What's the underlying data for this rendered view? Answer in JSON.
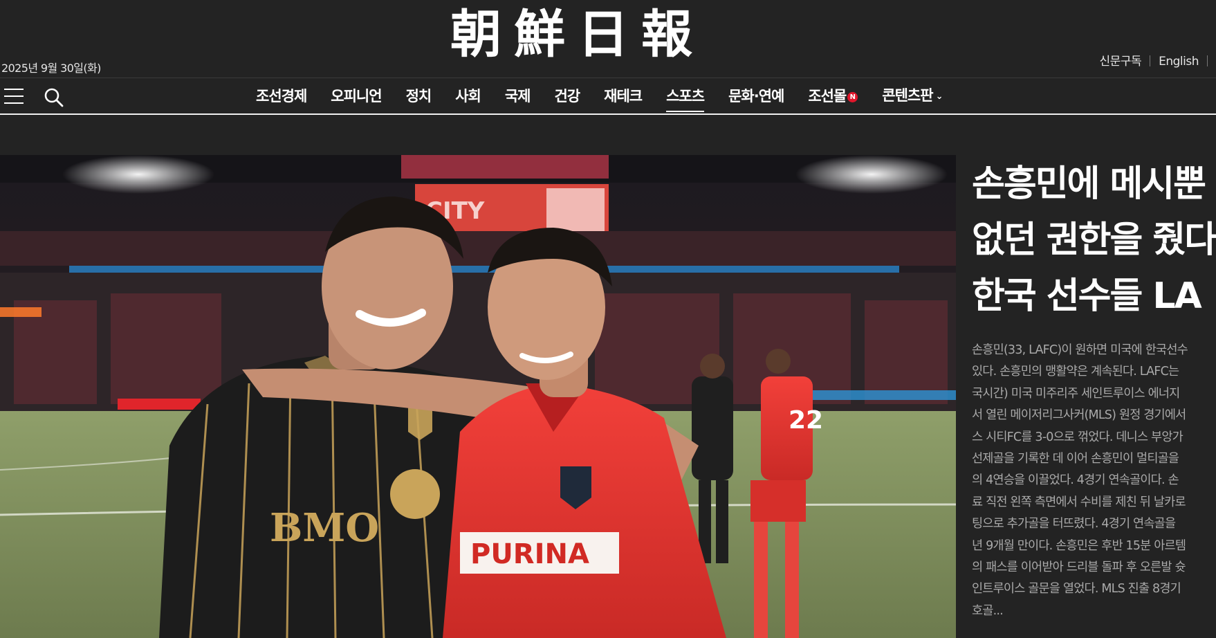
{
  "header": {
    "date": "2025년 9월 30일(화)",
    "logo_text": "朝鮮日報",
    "links": [
      "신문구독",
      "English"
    ]
  },
  "nav": {
    "items": [
      {
        "label": "조선경제"
      },
      {
        "label": "오피니언"
      },
      {
        "label": "정치"
      },
      {
        "label": "사회"
      },
      {
        "label": "국제"
      },
      {
        "label": "건강"
      },
      {
        "label": "재테크"
      },
      {
        "label": "스포츠",
        "active": true
      },
      {
        "label": "문화·연예"
      },
      {
        "label": "조선몰",
        "badge": "N"
      },
      {
        "label": "콘텐츠판",
        "dropdown": true
      }
    ],
    "menu_icon": "hamburger-icon",
    "search_icon": "search-icon"
  },
  "hero": {
    "scoreboard_text": "CITY",
    "left_jersey_sponsor": "BMO",
    "right_jersey_sponsor": "PURINA",
    "player_number": "22"
  },
  "story": {
    "headline": "손흥민에 메시뿐\n없던 권한을 줬다\n한국 선수들 LA",
    "summary": "손흥민(33, LAFC)이 원하면 미국에 한국선수\n있다. 손흥민의 맹활약은 계속된다. LAFC는\n국시간) 미국 미주리주 세인트루이스 에너지\n서 열린 메이저리그사커(MLS) 원정 경기에서\n스 시티FC를 3-0으로 꺾었다. 데니스 부앙가\n선제골을 기록한 데 이어 손흥민이 멀티골을\n의 4연승을 이끌었다. 4경기 연속골이다. 손\n료 직전 왼쪽 측면에서 수비를 제친 뒤 날카로\n팅으로 추가골을 터뜨렸다. 4경기 연속골을\n년 9개월 만이다. 손흥민은 후반 15분 아르템\n의 패스를 이어받아 드리블 돌파 후 오른발 슛\n인트루이스 골문을 열었다. MLS 진출 8경기\n호골..."
  },
  "colors": {
    "background": "#232323",
    "text": "#ffffff",
    "summary_text": "#aaaaaa",
    "badge": "#e0162b",
    "lafc_black": "#1c1c1c",
    "lafc_gold": "#c9a45a",
    "stlouis_red": "#e8312f"
  }
}
